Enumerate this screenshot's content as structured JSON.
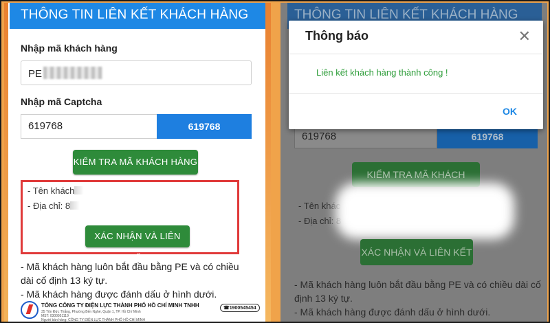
{
  "left": {
    "header_title": "THÔNG TIN LIÊN KẾT KHÁCH HÀNG",
    "customer_code_label": "Nhập mã khách hàng",
    "customer_code_value": "PE",
    "captcha_label": "Nhập mã Captcha",
    "captcha_value": "619768",
    "captcha_image_text": "619768",
    "check_button": "KIỂM TRA MÃ KHÁCH HÀNG",
    "result": {
      "name_label": "- Tên khách",
      "address_label": "- Địa chỉ: 8"
    },
    "confirm_button": "XÁC NHẬN VÀ LIÊN KẾT",
    "notes": [
      "- Mã khách hàng luôn bắt đầu bằng PE và có chiều dài cố định 13 ký tự.",
      "- Mã khách hàng được đánh dấu ở hình dưới."
    ],
    "footer": {
      "company": "TỔNG CÔNG TY ĐIỆN LỰC THÀNH PHỐ HỒ CHÍ MINH TNHH",
      "address_line": "35 Tôn Đức Thắng, Phường Bến Nghé, Quận 1, TP. Hồ Chí Minh",
      "mst_line": "MST: 0300951119",
      "branch_line": "Người bán hàng: CÔNG TY ĐIỆN LỰC THÀNH PHỐ HỒ CHÍ MINH",
      "hotline": "1900545454"
    }
  },
  "right": {
    "header_title": "THÔNG TIN LIÊN KẾT KHÁCH HÀNG",
    "captcha_value": "619768",
    "captcha_image_text": "619768",
    "check_button": "KIỂM TRA MÃ KHÁCH HÀNG",
    "name_label": "- Tên khác",
    "address_label": "- Địa chỉ: 8",
    "confirm_button": "XÁC NHẬN VÀ LIÊN KẾT",
    "notes": [
      "- Mã khách hàng luôn bắt đầu bằng PE và có chiều dài cố định 13 ký tự.",
      "- Mã khách hàng được đánh dấu ở hình dưới."
    ],
    "dialog": {
      "title": "Thông báo",
      "close_icon": "✕",
      "message": "Liên kết khách hàng thành công !",
      "ok_label": "OK"
    }
  },
  "colors": {
    "header_blue": "#1e88e5",
    "button_green": "#2e8b3a",
    "highlight_red": "#e03a3a",
    "success_green": "#2e9d3a"
  }
}
